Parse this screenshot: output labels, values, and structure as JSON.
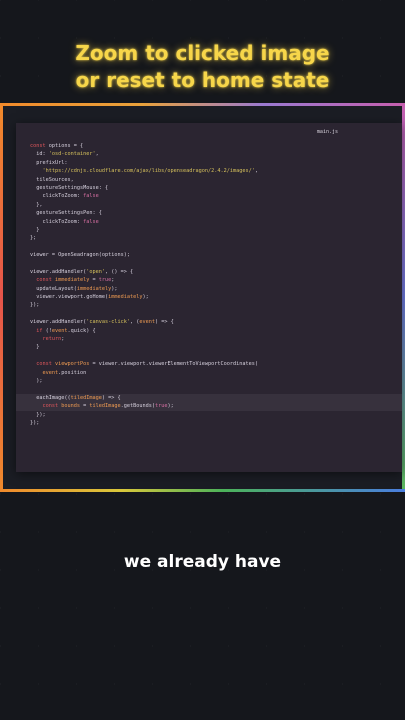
{
  "headline": {
    "line1": "Zoom to clicked image",
    "line2": "or reset to home state"
  },
  "editor": {
    "file_tab": "main.js",
    "code_lines": [
      [
        {
          "t": "const ",
          "c": "kw"
        },
        {
          "t": "options = {",
          "c": ""
        }
      ],
      [
        {
          "t": "  id: ",
          "c": ""
        },
        {
          "t": "'osd-container'",
          "c": "str"
        },
        {
          "t": ",",
          "c": ""
        }
      ],
      [
        {
          "t": "  prefixUrl:",
          "c": ""
        }
      ],
      [
        {
          "t": "    ",
          "c": ""
        },
        {
          "t": "'https://cdnjs.cloudflare.com/ajax/libs/openseadragon/2.4.2/images/'",
          "c": "str"
        },
        {
          "t": ",",
          "c": ""
        }
      ],
      [
        {
          "t": "  tileSources,",
          "c": ""
        }
      ],
      [
        {
          "t": "  gestureSettingsMouse: {",
          "c": ""
        }
      ],
      [
        {
          "t": "    clickToZoom: ",
          "c": ""
        },
        {
          "t": "false",
          "c": "bool"
        }
      ],
      [
        {
          "t": "  },",
          "c": ""
        }
      ],
      [
        {
          "t": "  gestureSettingsPen: {",
          "c": ""
        }
      ],
      [
        {
          "t": "    clickToZoom: ",
          "c": ""
        },
        {
          "t": "false",
          "c": "bool"
        }
      ],
      [
        {
          "t": "  }",
          "c": ""
        }
      ],
      [
        {
          "t": "};",
          "c": ""
        }
      ],
      [
        {
          "t": "",
          "c": ""
        }
      ],
      [
        {
          "t": "viewer = OpenSeadragon(options);",
          "c": ""
        }
      ],
      [
        {
          "t": "",
          "c": ""
        }
      ],
      [
        {
          "t": "viewer.addHandler(",
          "c": ""
        },
        {
          "t": "'open'",
          "c": "str"
        },
        {
          "t": ", () => {",
          "c": ""
        }
      ],
      [
        {
          "t": "  ",
          "c": ""
        },
        {
          "t": "const ",
          "c": "kw"
        },
        {
          "t": "immediately",
          "c": "param"
        },
        {
          "t": " = ",
          "c": ""
        },
        {
          "t": "true",
          "c": "bool"
        },
        {
          "t": ";",
          "c": ""
        }
      ],
      [
        {
          "t": "  updateLayout(",
          "c": ""
        },
        {
          "t": "immediately",
          "c": "param"
        },
        {
          "t": ");",
          "c": ""
        }
      ],
      [
        {
          "t": "  viewer.viewport.goHome(",
          "c": ""
        },
        {
          "t": "immediately",
          "c": "param"
        },
        {
          "t": ");",
          "c": ""
        }
      ],
      [
        {
          "t": "});",
          "c": ""
        }
      ],
      [
        {
          "t": "",
          "c": ""
        }
      ],
      [
        {
          "t": "viewer.addHandler(",
          "c": ""
        },
        {
          "t": "'canvas-click'",
          "c": "str"
        },
        {
          "t": ", (",
          "c": ""
        },
        {
          "t": "event",
          "c": "param"
        },
        {
          "t": ") => {",
          "c": ""
        }
      ],
      [
        {
          "t": "  ",
          "c": ""
        },
        {
          "t": "if ",
          "c": "kw"
        },
        {
          "t": "(!",
          "c": ""
        },
        {
          "t": "event",
          "c": "param"
        },
        {
          "t": ".quick) {",
          "c": ""
        }
      ],
      [
        {
          "t": "    ",
          "c": ""
        },
        {
          "t": "return",
          "c": "kw"
        },
        {
          "t": ";",
          "c": ""
        }
      ],
      [
        {
          "t": "  }",
          "c": ""
        }
      ],
      [
        {
          "t": "",
          "c": ""
        }
      ],
      [
        {
          "t": "  ",
          "c": ""
        },
        {
          "t": "const ",
          "c": "kw"
        },
        {
          "t": "viewportPos",
          "c": "param"
        },
        {
          "t": " = viewer.viewport.viewerElementToViewportCoordinates(",
          "c": ""
        }
      ],
      [
        {
          "t": "    ",
          "c": ""
        },
        {
          "t": "event",
          "c": "param"
        },
        {
          "t": ".position",
          "c": ""
        }
      ],
      [
        {
          "t": "  );",
          "c": ""
        }
      ],
      [
        {
          "t": "",
          "c": ""
        }
      ],
      [
        {
          "t": "  eachImage((",
          "c": ""
        },
        {
          "t": "tiledImage",
          "c": "param"
        },
        {
          "t": ") => {",
          "c": ""
        }
      ],
      [
        {
          "t": "    ",
          "c": ""
        },
        {
          "t": "const ",
          "c": "kw"
        },
        {
          "t": "bounds",
          "c": "param"
        },
        {
          "t": " = ",
          "c": ""
        },
        {
          "t": "tiledImage",
          "c": "param"
        },
        {
          "t": ".getBounds(",
          "c": ""
        },
        {
          "t": "true",
          "c": "bool"
        },
        {
          "t": ");",
          "c": ""
        }
      ],
      [
        {
          "t": "  });",
          "c": ""
        }
      ],
      [
        {
          "t": "});",
          "c": ""
        }
      ]
    ],
    "highlighted_lines": [
      30,
      31
    ]
  },
  "subtitle": "we already have",
  "colors": {
    "headline": "#f7d64a",
    "background": "#15171c",
    "editor_bg": "#2b2531",
    "keyword": "#e0575c",
    "string": "#d6c15c",
    "boolean": "#d36ea0",
    "parameter": "#ef9b52"
  }
}
